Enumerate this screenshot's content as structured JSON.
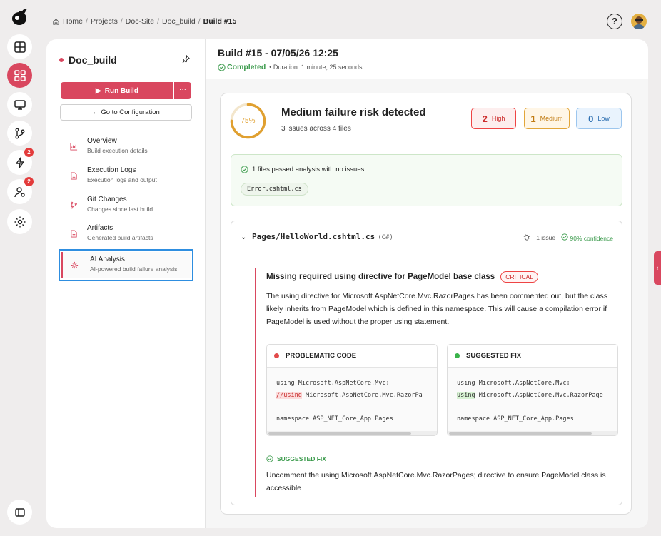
{
  "breadcrumb": {
    "items": [
      "Home",
      "Projects",
      "Doc-Site",
      "Doc_build"
    ],
    "current": "Build #15",
    "separator": "/"
  },
  "header": {
    "help_label": "?"
  },
  "rail": {
    "badges": {
      "activity": "2",
      "users": "2"
    }
  },
  "panel": {
    "project_name": "Doc_build",
    "run_label": "Run Build",
    "more_label": "···",
    "config_label": "← Go to Configuration",
    "nav": [
      {
        "title": "Overview",
        "subtitle": "Build execution details"
      },
      {
        "title": "Execution Logs",
        "subtitle": "Execution logs and output"
      },
      {
        "title": "Git Changes",
        "subtitle": "Changes since last build"
      },
      {
        "title": "Artifacts",
        "subtitle": "Generated build artifacts"
      },
      {
        "title": "AI Analysis",
        "subtitle": "AI-powered build failure analysis"
      }
    ]
  },
  "build": {
    "title": "Build #15 - 07/05/26 12:25",
    "status": "Completed",
    "duration": "• Duration: 1 minute, 25 seconds"
  },
  "analysis": {
    "risk_percent": "75%",
    "risk_fraction": 0.75,
    "title": "Medium failure risk detected",
    "subtitle": "3 issues across 4 files",
    "severity": {
      "high": {
        "count": "2",
        "label": "High"
      },
      "medium": {
        "count": "1",
        "label": "Medium"
      },
      "low": {
        "count": "0",
        "label": "Low"
      }
    },
    "passed_text": "1 files passed analysis with no issues",
    "passed_files": [
      "Error.cshtml.cs"
    ]
  },
  "file": {
    "name": "Pages/HelloWorld.cshtml.cs",
    "lang": "(C#)",
    "issues": "1 issue",
    "confidence": "90% confidence",
    "issue": {
      "title": "Missing required using directive for PageModel base class",
      "severity": "CRITICAL",
      "description": "The using directive for Microsoft.AspNetCore.Mvc.RazorPages has been commented out, but the class likely inherits from PageModel which is defined in this namespace. This will cause a compilation error if PageModel is used without the proper using statement.",
      "problem_label": "PROBLEMATIC CODE",
      "fix_label": "SUGGESTED FIX",
      "problem_code": {
        "line1": "using Microsoft.AspNetCore.Mvc;",
        "line2_hl": "//using",
        "line2_rest": " Microsoft.AspNetCore.Mvc.RazorPa",
        "line4": "namespace ASP_NET_Core_App.Pages"
      },
      "fix_code": {
        "line1": "using Microsoft.AspNetCore.Mvc;",
        "line2_hl": "using",
        "line2_rest": " Microsoft.AspNetCore.Mvc.RazorPage",
        "line4": "namespace ASP_NET_Core_App.Pages"
      },
      "suggested_fix_label": "SUGGESTED FIX",
      "suggested_fix_text": "Uncomment the using Microsoft.AspNetCore.Mvc.RazorPages; directive to ensure PageModel class is accessible"
    }
  },
  "colors": {
    "brand": "#d9475f",
    "success": "#3a9a4b",
    "warning": "#e0a030"
  }
}
